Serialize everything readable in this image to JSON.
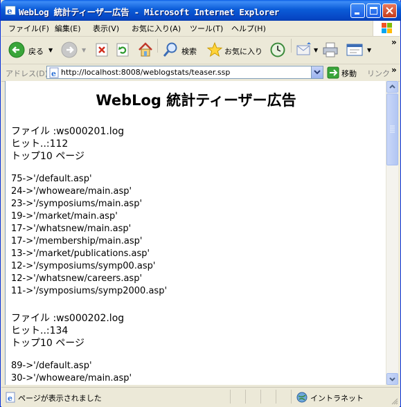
{
  "window": {
    "title": "WebLog 統計ティーザー広告 - Microsoft Internet Explorer"
  },
  "menu": [
    "ファイル(F)",
    "編集(E)",
    "表示(V)",
    "お気に入り(A)",
    "ツール(T)",
    "ヘルプ(H)"
  ],
  "toolbar": {
    "back_label": "戻る",
    "search_label": "検索",
    "favorites_label": "お気に入り",
    "overflow": "»"
  },
  "address": {
    "label": "アドレス(D)",
    "url": "http://localhost:8008/weblogstats/teaser.ssp",
    "go_label": "移動",
    "links_label": "リンク",
    "overflow": "»"
  },
  "page": {
    "heading": "WebLog 統計ティーザー広告",
    "sections": [
      {
        "file": "ファイル :ws000201.log",
        "hits": "ヒット..:112",
        "top": "トップ10 ページ",
        "pages": [
          "75->'/default.asp'",
          "24->'/whoweare/main.asp'",
          "23->'/symposiums/main.asp'",
          "19->'/market/main.asp'",
          "17->'/whatsnew/main.asp'",
          "17->'/membership/main.asp'",
          "13->'/market/publications.asp'",
          "12->'/symposiums/symp00.asp'",
          "12->'/whatsnew/careers.asp'",
          "11->'/symposiums/symp2000.asp'"
        ]
      },
      {
        "file": "ファイル :ws000202.log",
        "hits": "ヒット..:134",
        "top": "トップ10 ページ",
        "pages": [
          "89->'/default.asp'",
          "30->'/whoweare/main.asp'"
        ]
      }
    ]
  },
  "status": {
    "text": "ページが表示されました",
    "zone": "イントラネット"
  },
  "colors": {
    "titlebar": "#0b5cd8",
    "chrome": "#ece9d8",
    "close_button": "#c53b1a"
  }
}
